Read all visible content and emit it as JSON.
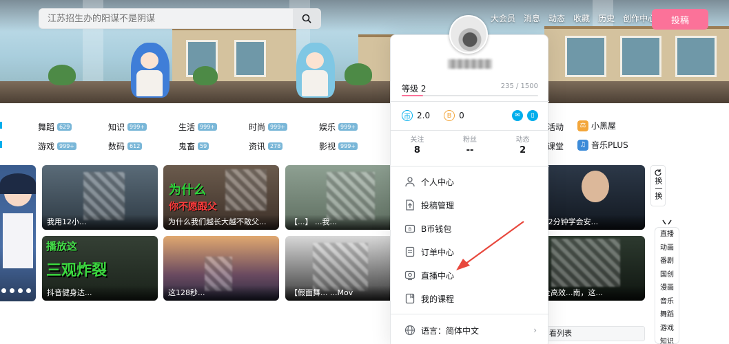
{
  "search": {
    "placeholder": "江苏招生办的阳谋不是阴谋"
  },
  "topnav": {
    "items": [
      "大会员",
      "消息",
      "动态",
      "收藏",
      "历史",
      "创作中心"
    ],
    "upload_label": "投稿"
  },
  "categories": [
    {
      "label": "舞蹈",
      "count": "629"
    },
    {
      "label": "知识",
      "count": "999+"
    },
    {
      "label": "生活",
      "count": "999+"
    },
    {
      "label": "时尚",
      "count": "999+"
    },
    {
      "label": "娱乐",
      "count": "999+"
    },
    {
      "label": "游戏",
      "count": "999+"
    },
    {
      "label": "数码",
      "count": "612"
    },
    {
      "label": "鬼畜",
      "count": "59"
    },
    {
      "label": "资讯",
      "count": "278"
    },
    {
      "label": "影视",
      "count": "999+"
    }
  ],
  "categories_right": [
    {
      "label": "活动"
    },
    {
      "label": "小黑屋"
    },
    {
      "label": "课堂"
    },
    {
      "label": "音乐PLUS"
    }
  ],
  "videos": [
    {
      "title": "我用12小..."
    },
    {
      "title": "为什么我们越长大越不敢父..."
    },
    {
      "title": "【...】  ...我..."
    },
    {
      "title": "抖音健身达..."
    },
    {
      "title": "这128秒..."
    },
    {
      "title": "【假面舞...  ...Mov"
    },
    {
      "title": "R】2分钟学会安..."
    },
    {
      "title": "最全高效...南，这..."
    }
  ],
  "video_overlays": [
    {
      "text": "为什么"
    },
    {
      "text": "你不愿跟父"
    },
    {
      "text": "播放这"
    },
    {
      "text": "三观炸裂"
    }
  ],
  "refresh_label": "换一换",
  "rail_items": [
    "直播",
    "动画",
    "番剧",
    "国创",
    "漫画",
    "音乐",
    "舞蹈",
    "游戏",
    "知识"
  ],
  "watchlist_label": "看列表",
  "panel": {
    "level_label": "等级 2",
    "level_progress": "235 / 1500",
    "level_fraction": 0.157,
    "coins": {
      "coin_value": "2.0",
      "bcoin_value": "0"
    },
    "stats": [
      {
        "label": "关注",
        "value": "8"
      },
      {
        "label": "粉丝",
        "value": "--"
      },
      {
        "label": "动态",
        "value": "2"
      }
    ],
    "menu": [
      {
        "label": "个人中心",
        "icon": "user-icon"
      },
      {
        "label": "投稿管理",
        "icon": "upload-manage-icon"
      },
      {
        "label": "B币钱包",
        "icon": "wallet-icon"
      },
      {
        "label": "订单中心",
        "icon": "order-icon"
      },
      {
        "label": "直播中心",
        "icon": "live-icon"
      },
      {
        "label": "我的课程",
        "icon": "course-icon"
      }
    ],
    "language_label": "语言：简体中文"
  },
  "colors": {
    "accent": "#00aeec",
    "pink": "#fb7299",
    "arrow": "#e8483d"
  }
}
